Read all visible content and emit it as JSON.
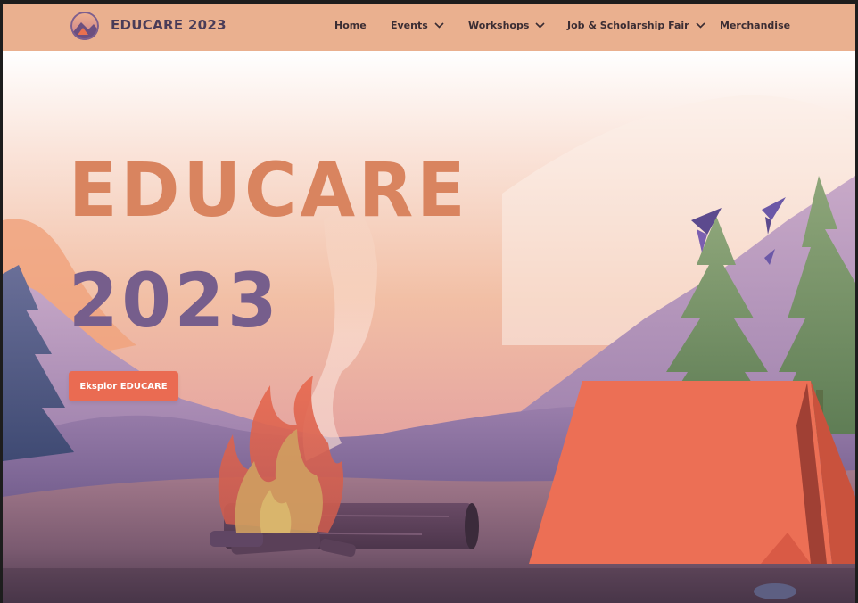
{
  "header": {
    "brand": "EDUCARE 2023",
    "nav": [
      {
        "label": "Home",
        "has_dropdown": false
      },
      {
        "label": "Events",
        "has_dropdown": true
      },
      {
        "label": "Workshops",
        "has_dropdown": true
      },
      {
        "label": "Job & Scholarship Fair",
        "has_dropdown": true
      },
      {
        "label": "Merchandise",
        "has_dropdown": false
      }
    ]
  },
  "hero": {
    "title_line1": "EDUCARE",
    "title_line2": "2023",
    "cta_label": "Eksplor EDUCARE"
  },
  "colors": {
    "nav_bg": "#eab08f",
    "title_orange": "#d9845f",
    "title_purple": "#765e8c",
    "cta_bg": "#ea6b52",
    "tent": "#ec6f55"
  }
}
